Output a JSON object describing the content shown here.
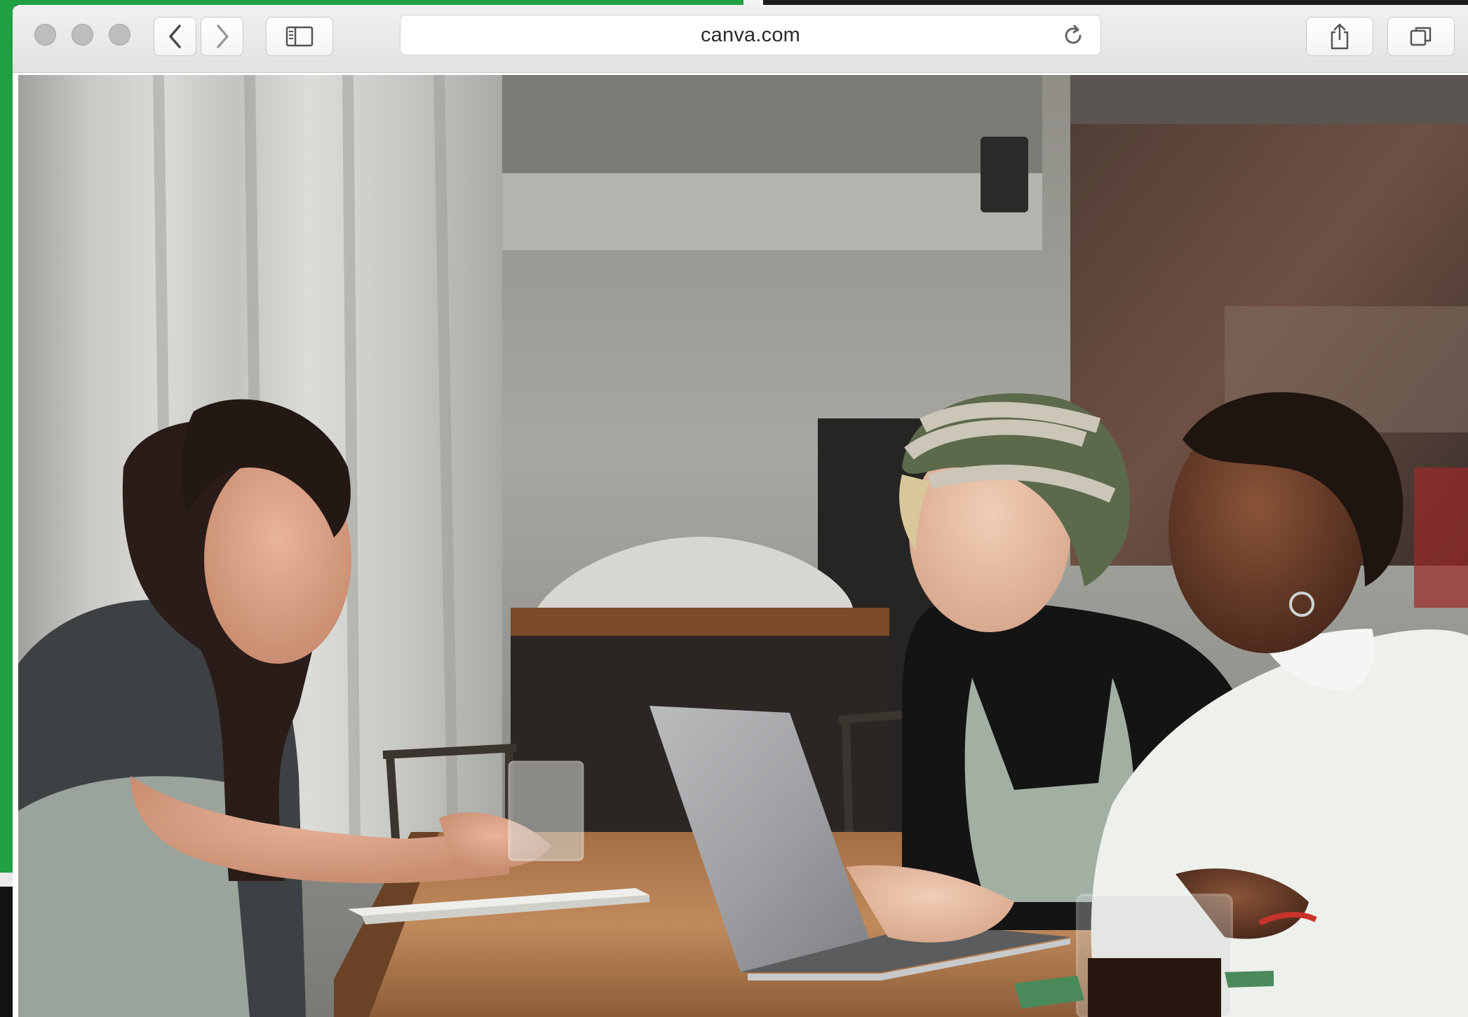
{
  "browser": {
    "address": "canva.com",
    "buttons": {
      "back": "chevron-left-icon",
      "forward": "chevron-right-icon",
      "sidebar": "sidebar-icon",
      "reload": "reload-icon",
      "share": "share-icon",
      "tabs": "tabs-icon"
    }
  },
  "photo": {
    "subject": "three-people-at-laptop"
  },
  "colors": {
    "desktop_green": "#1fa043",
    "toolbar": "#e6e6e6"
  }
}
